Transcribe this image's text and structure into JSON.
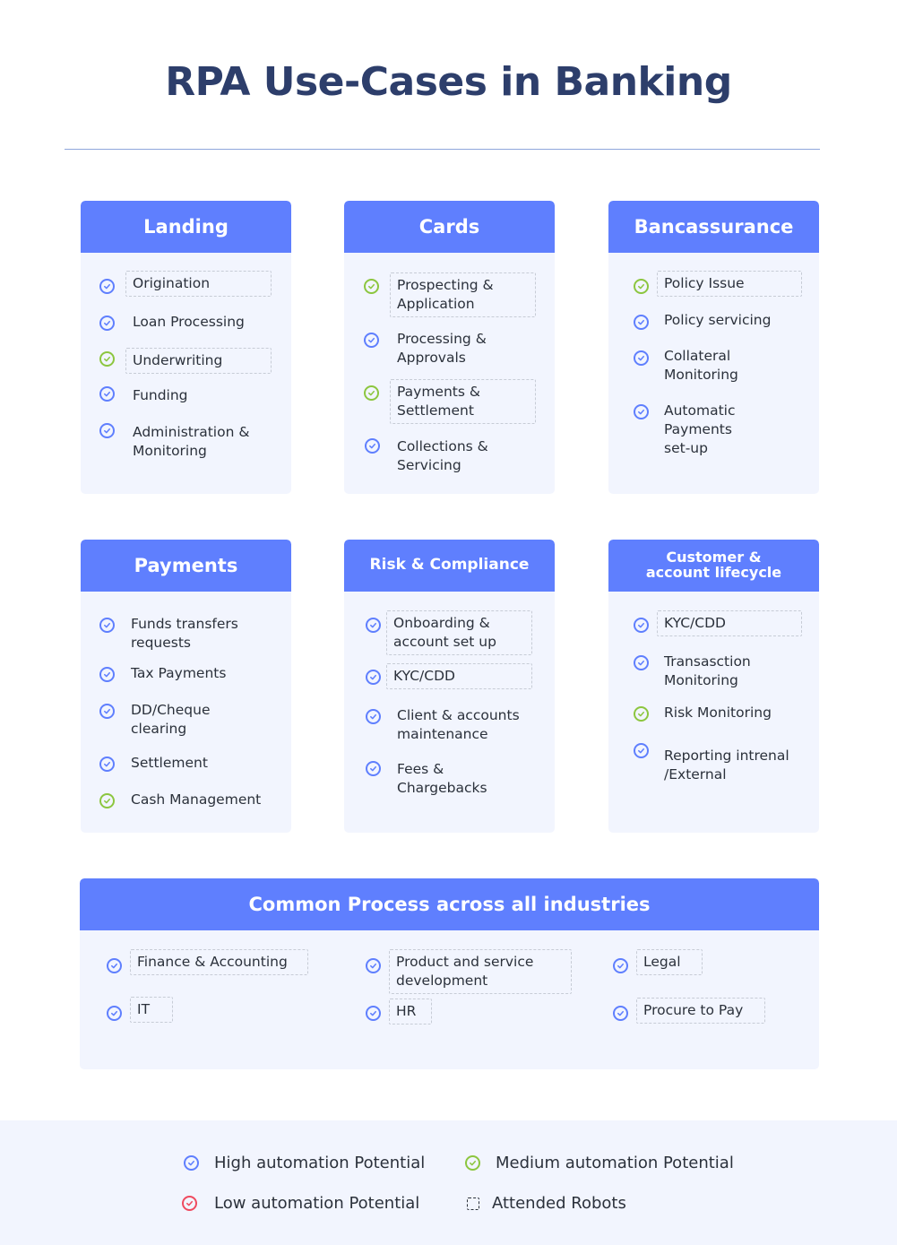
{
  "title": "RPA Use-Cases in Banking",
  "colors": {
    "high": "#5f7ffe",
    "medium": "#8cc63f",
    "low": "#ef4a5f",
    "header_bg": "#5f7ffe",
    "card_bg": "#f2f5fe",
    "title": "#2d3e6b"
  },
  "cards": [
    {
      "title": "Landing",
      "items": [
        {
          "label": "Origination",
          "potential": "high",
          "attended": true
        },
        {
          "label": "Loan Processing",
          "potential": "high",
          "attended": false
        },
        {
          "label": "Underwriting",
          "potential": "medium",
          "attended": true
        },
        {
          "label": "Funding",
          "potential": "high",
          "attended": false
        },
        {
          "label": "Administration & Monitoring",
          "potential": "high",
          "attended": false
        }
      ]
    },
    {
      "title": "Cards",
      "items": [
        {
          "label": "Prospecting & Application",
          "potential": "medium",
          "attended": true
        },
        {
          "label": "Processing & Approvals",
          "potential": "high",
          "attended": false
        },
        {
          "label": "Payments & Settlement",
          "potential": "medium",
          "attended": true
        },
        {
          "label": "Collections & Servicing",
          "potential": "high",
          "attended": false
        }
      ]
    },
    {
      "title": "Bancassurance",
      "items": [
        {
          "label": "Policy Issue",
          "potential": "medium",
          "attended": true
        },
        {
          "label": "Policy servicing",
          "potential": "high",
          "attended": false
        },
        {
          "label": "Collateral Monitoring",
          "potential": "high",
          "attended": false
        },
        {
          "label": "Automatic Payments set-up",
          "potential": "high",
          "attended": false
        }
      ]
    },
    {
      "title": "Payments",
      "items": [
        {
          "label": "Funds transfers requests",
          "potential": "high",
          "attended": false
        },
        {
          "label": "Tax Payments",
          "potential": "high",
          "attended": false
        },
        {
          "label": "DD/Cheque clearing",
          "potential": "high",
          "attended": false
        },
        {
          "label": "Settlement",
          "potential": "high",
          "attended": false
        },
        {
          "label": "Cash Management",
          "potential": "medium",
          "attended": false
        }
      ]
    },
    {
      "title": "Risk & Compliance",
      "items": [
        {
          "label": "Onboarding & account set up",
          "potential": "high",
          "attended": true
        },
        {
          "label": "KYC/CDD",
          "potential": "high",
          "attended": true
        },
        {
          "label": "Client & accounts maintenance",
          "potential": "high",
          "attended": false
        },
        {
          "label": "Fees & Chargebacks",
          "potential": "high",
          "attended": false
        }
      ]
    },
    {
      "title": "Customer & account lifecycle",
      "items": [
        {
          "label": "KYC/CDD",
          "potential": "high",
          "attended": true
        },
        {
          "label": "Transasction Monitoring",
          "potential": "high",
          "attended": false
        },
        {
          "label": "Risk Monitoring",
          "potential": "medium",
          "attended": false
        },
        {
          "label": "Reporting intrenal /External",
          "potential": "high",
          "attended": false
        }
      ]
    }
  ],
  "common": {
    "title": "Common Process across all industries",
    "items": [
      {
        "label": "Finance & Accounting",
        "potential": "high",
        "attended": true
      },
      {
        "label": "Product and service development",
        "potential": "high",
        "attended": true
      },
      {
        "label": "Legal",
        "potential": "high",
        "attended": true
      },
      {
        "label": "IT",
        "potential": "high",
        "attended": true
      },
      {
        "label": "HR",
        "potential": "high",
        "attended": true
      },
      {
        "label": "Procure to Pay",
        "potential": "high",
        "attended": true
      }
    ]
  },
  "legend": [
    {
      "label": "High automation Potential",
      "icon": "check-circle-blue-icon"
    },
    {
      "label": "Medium automation Potential",
      "icon": "check-circle-green-icon"
    },
    {
      "label": "Low automation Potential",
      "icon": "check-circle-red-icon"
    },
    {
      "label": "Attended Robots",
      "icon": "dashed-square-icon"
    }
  ]
}
